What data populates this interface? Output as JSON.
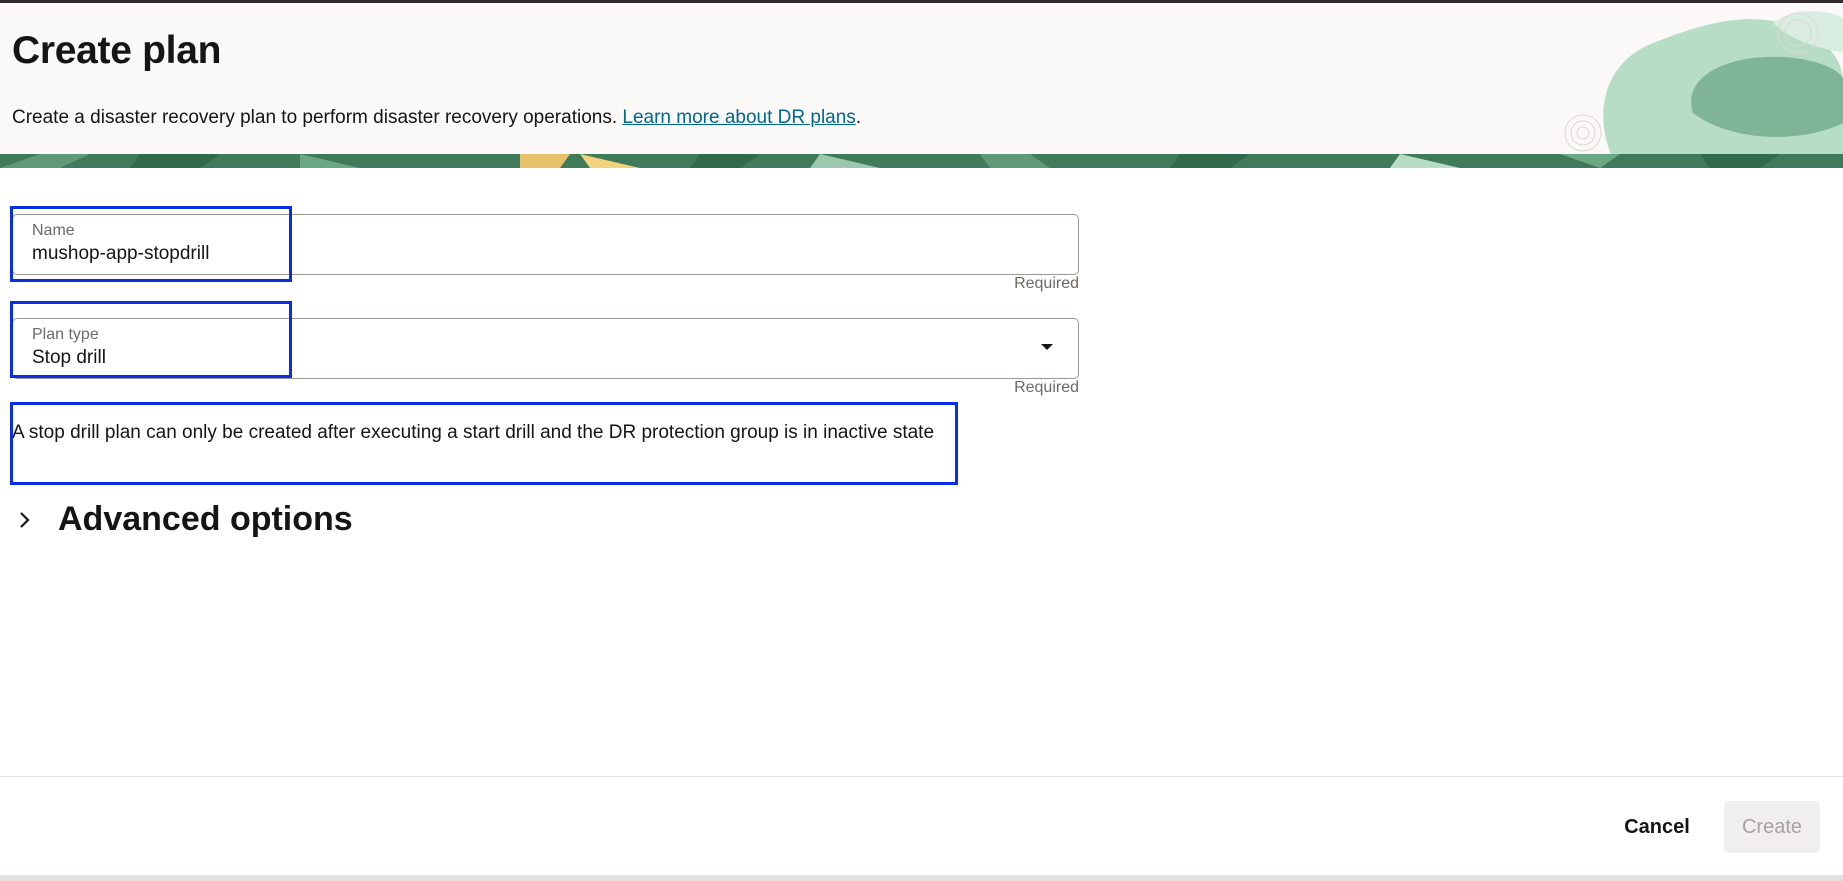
{
  "header": {
    "title": "Create plan",
    "description": "Create a disaster recovery plan to perform disaster recovery operations.",
    "link_text": "Learn more about DR plans",
    "trailing_punct": "."
  },
  "form": {
    "name": {
      "label": "Name",
      "value": "mushop-app-stopdrill",
      "hint": "Required"
    },
    "plan_type": {
      "label": "Plan type",
      "value": "Stop drill",
      "hint": "Required"
    },
    "info_text": "A stop drill plan can only be created after executing a start drill and the DR protection group is in inactive state"
  },
  "advanced": {
    "title": "Advanced options"
  },
  "footer": {
    "cancel_label": "Cancel",
    "create_label": "Create"
  },
  "colors": {
    "accent_link": "#00688c",
    "highlight_box": "#0a2ee3",
    "banner_green": "#3f7a5a"
  }
}
